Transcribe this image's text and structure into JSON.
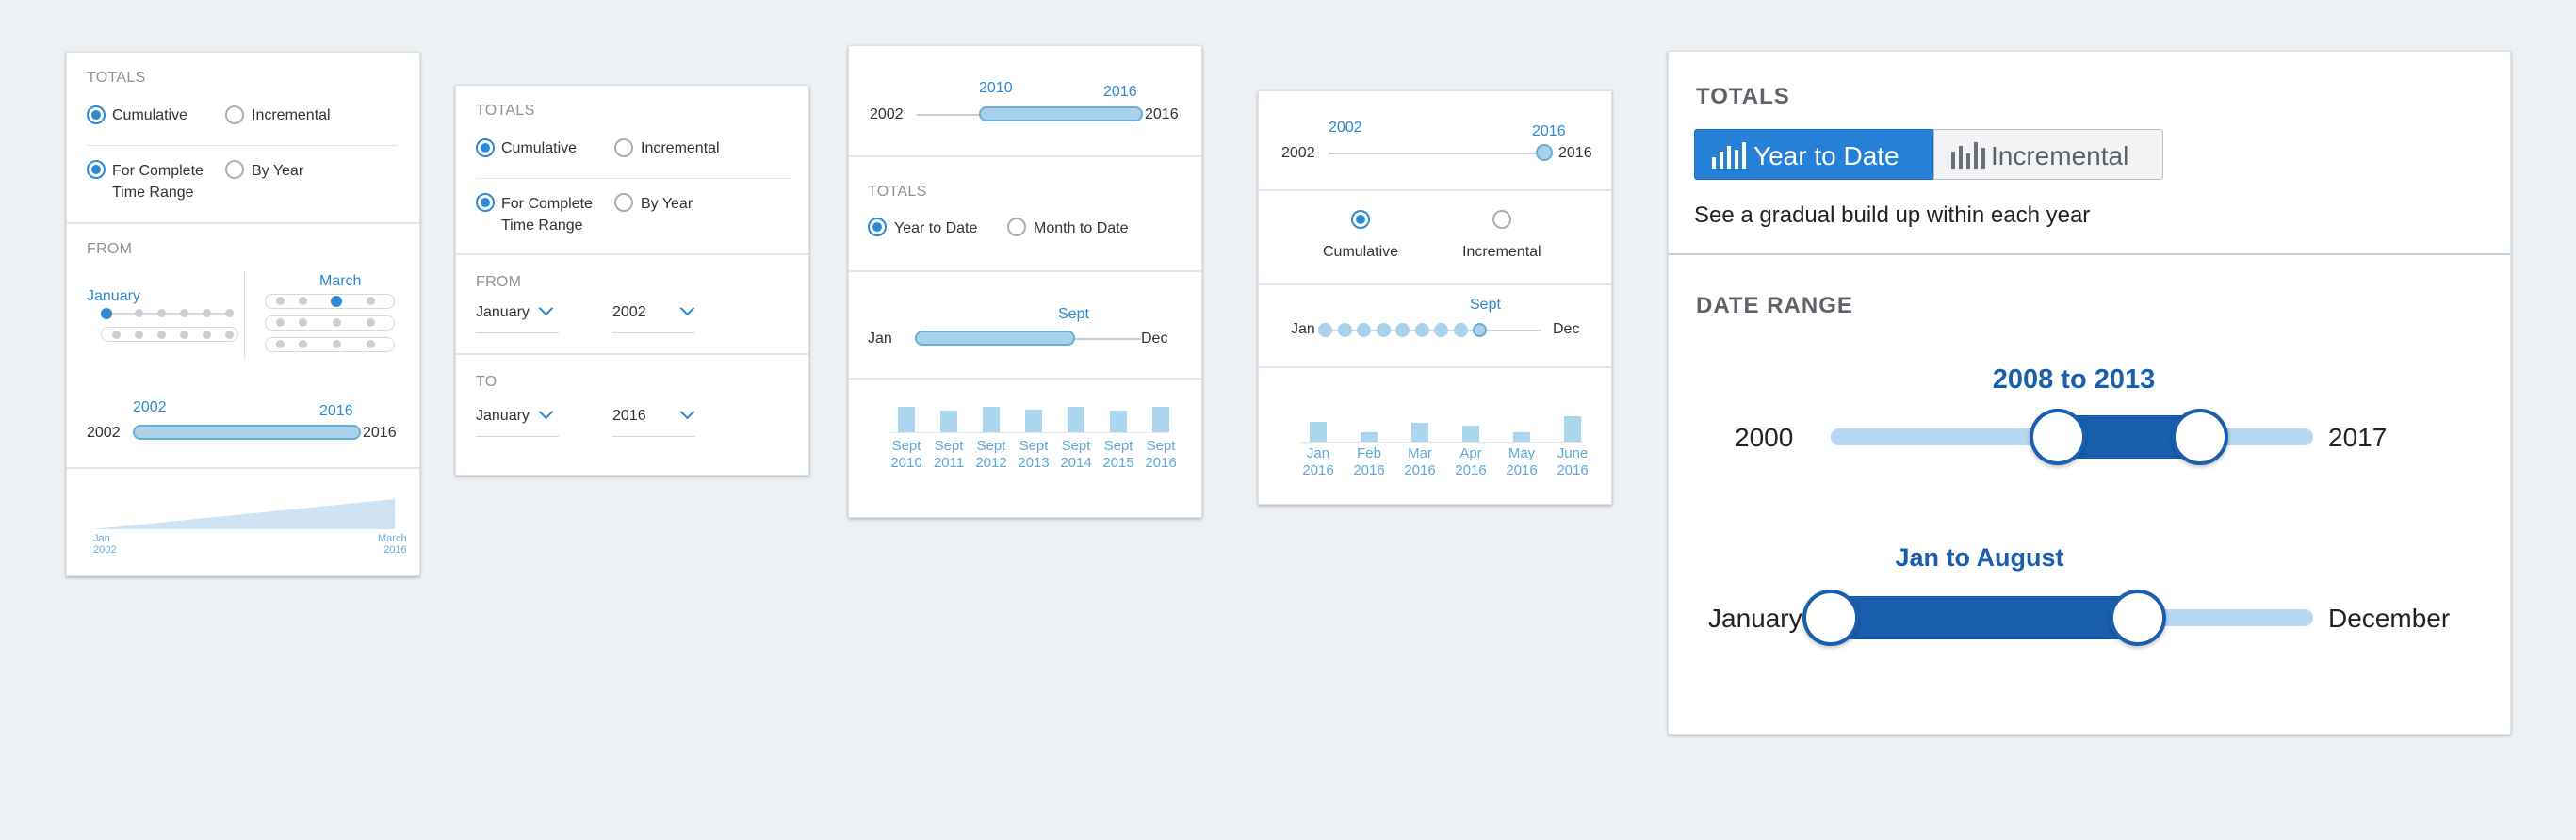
{
  "card1": {
    "totals_heading": "TOTALS",
    "cumulative_label": "Cumulative",
    "incremental_label": "Incremental",
    "complete_range_label_1": "For Complete",
    "complete_range_label_2": "Time Range",
    "by_year_label": "By Year",
    "from_heading": "FROM",
    "month_left": "January",
    "month_right": "March",
    "range_start_top": "2002",
    "range_end_top": "2016",
    "range_min": "2002",
    "range_max": "2016",
    "area_start_1": "Jan",
    "area_start_2": "2002",
    "area_end_1": "March",
    "area_end_2": "2016"
  },
  "card2": {
    "totals_heading": "TOTALS",
    "cumulative_label": "Cumulative",
    "incremental_label": "Incremental",
    "complete_range_label_1": "For Complete",
    "complete_range_label_2": "Time Range",
    "by_year_label": "By Year",
    "from_heading": "FROM",
    "from_month": "January",
    "from_year": "2002",
    "to_heading": "TO",
    "to_month": "January",
    "to_year": "2016"
  },
  "card3": {
    "range_min": "2002",
    "range_max": "2016",
    "range_start_top": "2010",
    "range_end_top": "2016",
    "totals_heading": "TOTALS",
    "ytd_label": "Year to Date",
    "mtd_label": "Month to Date",
    "month_min": "Jan",
    "month_max": "Dec",
    "month_sel": "Sept",
    "bar_values": [
      0.9,
      0.75,
      0.9,
      0.8,
      0.9,
      0.75,
      0.9
    ],
    "bar_labels": [
      [
        "Sept",
        "2010"
      ],
      [
        "Sept",
        "2011"
      ],
      [
        "Sept",
        "2012"
      ],
      [
        "Sept",
        "2013"
      ],
      [
        "Sept",
        "2014"
      ],
      [
        "Sept",
        "2015"
      ],
      [
        "Sept",
        "2016"
      ]
    ]
  },
  "card4": {
    "range_min": "2002",
    "range_max": "2016",
    "range_start_top": "2002",
    "range_end_top": "2016",
    "cumulative_label": "Cumulative",
    "incremental_label": "Incremental",
    "month_min": "Jan",
    "month_max": "Dec",
    "month_sel": "Sept",
    "bar_values": [
      0.75,
      0.35,
      0.7,
      0.6,
      0.35,
      0.95
    ],
    "bar_labels": [
      [
        "Jan",
        "2016"
      ],
      [
        "Feb",
        "2016"
      ],
      [
        "Mar",
        "2016"
      ],
      [
        "Apr",
        "2016"
      ],
      [
        "May",
        "2016"
      ],
      [
        "June",
        "2016"
      ]
    ]
  },
  "card5": {
    "totals_heading": "TOTALS",
    "ytd_button": "Year to Date",
    "incremental_button": "Incremental",
    "description": "See a gradual build up within each year",
    "date_range_heading": "DATE RANGE",
    "year_range_label": "2008 to 2013",
    "year_min": "2000",
    "year_max": "2017",
    "year_sel_start": 2008,
    "year_sel_end": 2013,
    "month_range_label": "Jan to August",
    "month_min": "January",
    "month_max": "December",
    "month_sel_start": 1,
    "month_sel_end": 8,
    "accent": "#1a5fad",
    "light_accent": "#b6d6f2"
  }
}
